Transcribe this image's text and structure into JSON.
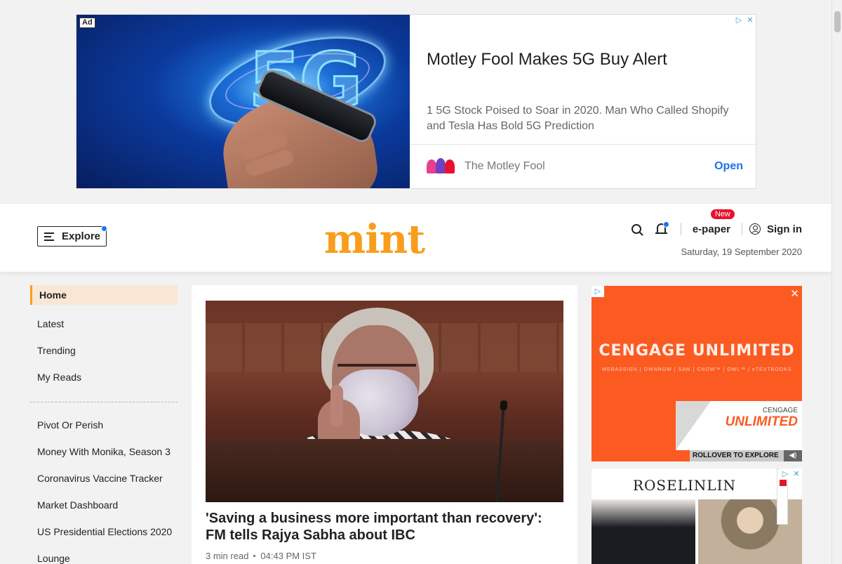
{
  "top_ad": {
    "label": "Ad",
    "title": "Motley Fool Makes 5G Buy Alert",
    "description": "1 5G Stock Poised to Soar in 2020. Man Who Called Shopify and Tesla Has Bold 5G Prediction",
    "brand": "The Motley Fool",
    "cta": "Open",
    "image_text": "5G"
  },
  "header": {
    "explore_label": "Explore",
    "logo": "mint",
    "epaper_label": "e-paper",
    "new_badge": "New",
    "signin_label": "Sign in",
    "date": "Saturday, 19 September 2020"
  },
  "sidebar": {
    "primary": [
      {
        "label": "Home",
        "active": true
      },
      {
        "label": "Latest"
      },
      {
        "label": "Trending"
      },
      {
        "label": "My Reads"
      }
    ],
    "secondary": [
      {
        "label": "Pivot Or Perish"
      },
      {
        "label": "Money With Monika, Season 3"
      },
      {
        "label": "Coronavirus Vaccine Tracker"
      },
      {
        "label": "Market Dashboard"
      },
      {
        "label": "US Presidential Elections 2020"
      },
      {
        "label": "Lounge"
      }
    ]
  },
  "main_story": {
    "headline": "'Saving a business more important than recovery': FM tells Rajya Sabha about IBC",
    "read_time": "3 min read",
    "time": "04:43 PM IST"
  },
  "side_ad_1": {
    "brand": "CENGAGE UNLIMITED",
    "brand_sub": "WEBASSIGN | OWNNOW | SAM | CNOW™ | OWL™ | eTEXTBOOKS",
    "peel_small": "CENGAGE",
    "peel_big": "UNLIMITED",
    "rollover": "ROLLOVER TO EXPLORE"
  },
  "side_ad_2": {
    "brand": "ROSELINLIN"
  },
  "colors": {
    "brand": "#f99d1c",
    "accent_blue": "#1877f2",
    "badge_red": "#e8132b",
    "active_bg": "#f9e7d6"
  }
}
